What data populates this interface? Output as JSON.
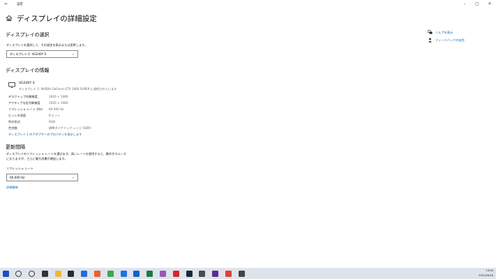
{
  "window": {
    "title": "設定",
    "back_glyph": "←",
    "controls": [
      "–",
      "▢",
      "✕"
    ]
  },
  "page": {
    "title": "ディスプレイの詳細設定"
  },
  "select_display": {
    "heading": "ディスプレイの選択",
    "description": "ディスプレイを選択して、その設定を表示または変更します。",
    "dropdown_value": "ディスプレイ 1: VG240Y S"
  },
  "display_info": {
    "heading": "ディスプレイの情報",
    "monitor_name": "VG240Y S",
    "monitor_sub": "ディスプレイ 1: NVIDIA GeForce GTX 1660 SUPER に接続されています",
    "rows": [
      {
        "label": "デスクトップの解像度",
        "value": "1920 × 1080"
      },
      {
        "label": "アクティブな信号解像度",
        "value": "1920 × 1080"
      },
      {
        "label": "リフレッシュ レート (Hz)",
        "value": "60.000 Hz"
      },
      {
        "label": "ビットの深度",
        "value": "8 ビット"
      },
      {
        "label": "色の形式",
        "value": "RGB"
      },
      {
        "label": "色空間",
        "value": "標準ダイナミック レンジ (SDR)"
      }
    ],
    "adapter_link": "ディスプレイ 1 のアダプターのプロパティを表示します"
  },
  "refresh": {
    "heading": "更新間隔",
    "description_line1": "ディスプレイのリフレッシュ レートを選びます。高いレートを使用すると、動作がスムーズ",
    "description_line2": "になりますが、さらに電力消費が増加します。",
    "rate_label": "リフレッシュ レート",
    "rate_value": "60.000 Hz",
    "details_link": "詳細情報"
  },
  "side_links": {
    "help": "ヘルプを表示",
    "feedback": "フィードバックの送信"
  },
  "taskbar": {
    "icons": [
      {
        "name": "start-icon",
        "color": "#1f4fbf"
      },
      {
        "name": "search-icon",
        "color": "#333333"
      },
      {
        "name": "cortana-icon",
        "color": "#333333"
      },
      {
        "name": "task-view-icon",
        "color": "#333333"
      },
      {
        "name": "explorer-icon",
        "color": "#f2b632"
      },
      {
        "name": "store-icon",
        "color": "#2b2b2b"
      },
      {
        "name": "mail-icon",
        "color": "#1e6fd9"
      },
      {
        "name": "firefox-icon",
        "color": "#e8622c"
      },
      {
        "name": "chrome-icon",
        "color": "#3aa757"
      },
      {
        "name": "messenger-icon",
        "color": "#1a73e8"
      },
      {
        "name": "outlook-icon",
        "color": "#0a64c9"
      },
      {
        "name": "excel-icon",
        "color": "#1f7a43"
      },
      {
        "name": "paint-icon",
        "color": "#9b59b6"
      },
      {
        "name": "record-icon",
        "color": "#d7262c"
      },
      {
        "name": "steam-icon",
        "color": "#1b2838"
      },
      {
        "name": "calculator-icon",
        "color": "#4a4a4a"
      },
      {
        "name": "media-icon",
        "color": "#5c2d91"
      },
      {
        "name": "chrome2-icon",
        "color": "#db4437"
      },
      {
        "name": "settings-icon",
        "color": "#444444"
      }
    ],
    "time": "13:00",
    "date": "2021/04/16"
  }
}
